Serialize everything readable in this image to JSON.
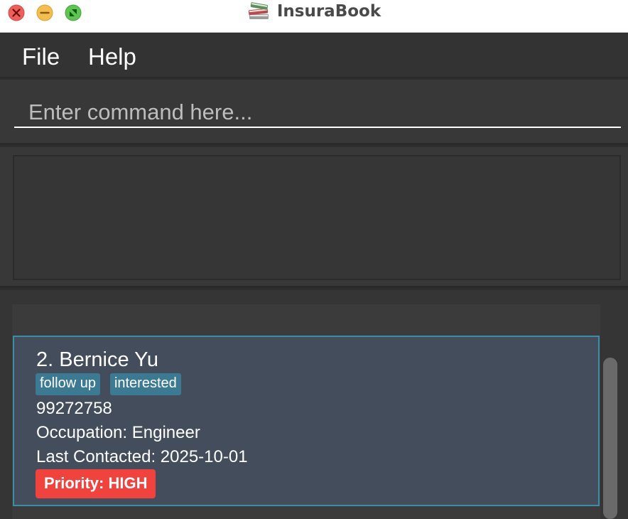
{
  "window": {
    "title": "InsuraBook",
    "icon": "book-stack-icon"
  },
  "menu": {
    "file_label": "File",
    "help_label": "Help"
  },
  "command": {
    "placeholder": "Enter command here...",
    "value": ""
  },
  "result_display": {
    "text": ""
  },
  "client_card": {
    "name": "2. Bernice Yu",
    "tags": [
      "follow up",
      "interested"
    ],
    "phone": "99272758",
    "occupation": "Occupation: Engineer",
    "last_contacted": "Last Contacted: 2025-10-01",
    "priority": "Priority: HIGH",
    "priority_color": "#f0433d",
    "tag_color": "#3c7a93",
    "selected_border_color": "#3a8fa6"
  },
  "colors": {
    "close": "#ec5f5a",
    "minimize": "#f4bd4f",
    "maximize": "#5fc454"
  }
}
